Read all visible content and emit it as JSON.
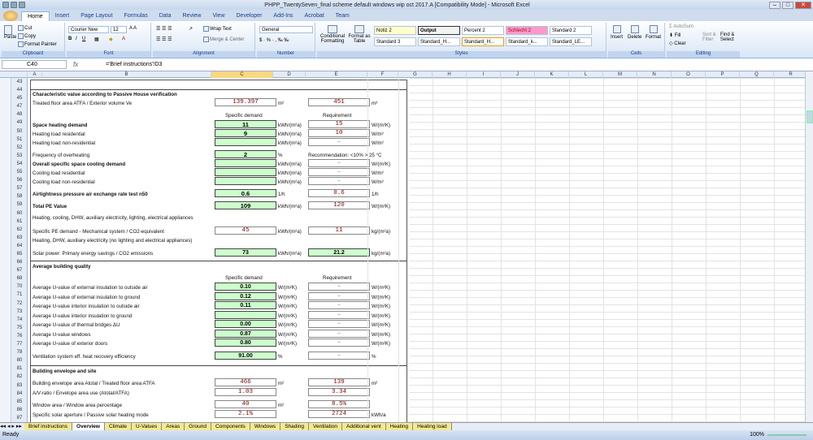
{
  "window": {
    "title": "PHPP_TwentySeven_final scheme default windows wip oct 2017.A  [Compatibility Mode] - Microsoft Excel"
  },
  "tabs": [
    "Home",
    "Insert",
    "Page Layout",
    "Formulas",
    "Data",
    "Review",
    "View",
    "Developer",
    "Add-Ins",
    "Acrobat",
    "Team"
  ],
  "ribbon": {
    "paste": "Paste",
    "cut": "Cut",
    "copy": "Copy",
    "format_painter": "Format Painter",
    "font_name": "Courier New",
    "font_size": "12",
    "wrap_text": "Wrap Text",
    "merge_center": "Merge & Center",
    "number_format": "General",
    "conditional_formatting": "Conditional Formatting",
    "format_as_table": "Format as Table",
    "styles": [
      "Notiz 2",
      "Output",
      "Percent 2",
      "Schlecht 2",
      "Standard 2",
      "Standard 3",
      "Standard_H...",
      "Standard_H...",
      "Standard_k...",
      "Standard_LE..."
    ],
    "insert": "Insert",
    "delete": "Delete",
    "format": "Format",
    "autosum": "AutoSum",
    "fill": "Fill",
    "clear": "Clear",
    "sort_filter": "Sort & Filter",
    "find_select": "Find & Select",
    "groups": [
      "Clipboard",
      "Font",
      "Alignment",
      "Number",
      "Styles",
      "Cells",
      "Editing"
    ]
  },
  "formula_bar": {
    "name_box": "C40",
    "fx": "fx",
    "formula": "='Brief instructions'!D3"
  },
  "columns": [
    "A",
    "B",
    "C",
    "D",
    "E",
    "F",
    "G",
    "H",
    "I",
    "J",
    "K",
    "L",
    "M",
    "N",
    "O",
    "P",
    "Q",
    "R",
    "S"
  ],
  "rows": [
    "43",
    "44",
    "45",
    "47",
    "48",
    "49",
    "50",
    "51",
    "52",
    "53",
    "54",
    "55",
    "56",
    "57",
    "58",
    "59",
    "60",
    "61",
    "62",
    "63",
    "64",
    "65",
    "66",
    "67",
    "68",
    "70",
    "71",
    "72",
    "73",
    "74",
    "75",
    "76",
    "77",
    "78",
    "80",
    "81",
    "82",
    "83",
    "84",
    "85",
    "86",
    "87"
  ],
  "sections": {
    "s1": "Characteristic value according to Passive House verification",
    "s2": "Average building quality",
    "s3": "Building envelope and site"
  },
  "headers": {
    "specific_demand": "Specific demand",
    "requirement": "Requirement"
  },
  "tfa": {
    "label": "Treated floor area ATFA / Exterior volume Ve",
    "value": "139.397",
    "unit": "m²",
    "req": "451",
    "req_unit": "m³"
  },
  "rows1": [
    {
      "label": "Space heating demand",
      "bold": true,
      "value": "11",
      "unit": "kWh/(m²a)",
      "req": "15",
      "req_unit": "W/(m²K)"
    },
    {
      "label": "Heating load residential",
      "bold": false,
      "value": "9",
      "unit": "kWh/(m²a)",
      "req": "10",
      "req_unit": "W/m²"
    },
    {
      "label": "Heating load non-residential",
      "bold": false,
      "value": "",
      "unit": "kWh/(m²a)",
      "req": "–",
      "req_unit": "W/m²"
    },
    {
      "label": "Frequency of overheating",
      "bold": false,
      "value": "2",
      "unit": "%",
      "req": "Recommendation: <10% > 25 °C",
      "req_unit": ""
    },
    {
      "label": "Overall specific space cooling demand",
      "bold": true,
      "value": "",
      "unit": "kWh/(m²a)",
      "req": "–",
      "req_unit": "W/(m²K)"
    },
    {
      "label": "Cooling load residential",
      "bold": false,
      "value": "",
      "unit": "kWh/(m²a)",
      "req": "–",
      "req_unit": "W/m²"
    },
    {
      "label": "Cooling load non-residential",
      "bold": false,
      "value": "",
      "unit": "kWh/(m²a)",
      "req": "–",
      "req_unit": "W/m²"
    },
    {
      "label": "Airtightness pressure air exchange rate test n50",
      "bold": true,
      "value": "0.6",
      "unit": "1/h",
      "req": "0.6",
      "req_unit": "1/h"
    },
    {
      "label": "Total PE Value",
      "bold": true,
      "value": "109",
      "unit": "kWh/(m²a)",
      "req": "120",
      "req_unit": "W/(m²K)"
    }
  ],
  "note1": "Heating, cooling, DHW, auxiliary electricity, lighting, electrical appliances",
  "pe_mech": {
    "label": "Specific PE demand - Mechanical system / CO2-equivalent",
    "value": "45",
    "unit": "kWh/(m²a)",
    "req": "11",
    "req_unit": "kg/(m²a)"
  },
  "note2": "Heating, DHW, auxiliary electricity (no lighting and electrical appliances)",
  "solar": {
    "label": "Solar power: Primary energy savings / CO2 emissions",
    "value": "73",
    "unit": "kWh/(m²a)",
    "req": "21.2",
    "req_unit": "kg/(m²a)"
  },
  "rows2": [
    {
      "label": "Average U-value of external insulation to outside air",
      "value": "0.10",
      "unit": "W/(m²K)",
      "req": "–",
      "req_unit": "W/(m²K)"
    },
    {
      "label": "Average U-value of external insulation to ground",
      "value": "0.12",
      "unit": "W/(m²K)",
      "req": "–",
      "req_unit": "W/(m²K)"
    },
    {
      "label": "Average U-value interior insulation to outside air",
      "value": "0.11",
      "unit": "W/(m²K)",
      "req": "–",
      "req_unit": "W/(m²K)"
    },
    {
      "label": "Average U-value interior insulation to ground",
      "value": "",
      "unit": "W/(m²K)",
      "req": "–",
      "req_unit": "W/(m²K)"
    },
    {
      "label": "Average U-value of thermal bridges ΔU",
      "value": "0.00",
      "unit": "W/(m²K)",
      "req": "–",
      "req_unit": "W/(m²K)"
    },
    {
      "label": "Average U-value windows",
      "value": "0.87",
      "unit": "W/(m²K)",
      "req": "–",
      "req_unit": "W/(m²K)"
    },
    {
      "label": "Average U-value of exterior doors",
      "value": "0.80",
      "unit": "W/(m²K)",
      "req": "–",
      "req_unit": "W/(m²K)"
    }
  ],
  "ventilation": {
    "label": "Ventilation system eff. heat recovery efficiency",
    "value": "91.00",
    "unit": "%",
    "req": "–",
    "req_unit": "%"
  },
  "rows3": [
    {
      "label": "Building envelope area Atotal / Treated floor area ATFA",
      "value": "466",
      "unit": "m²",
      "req": "139",
      "req_unit": "m²"
    },
    {
      "label": "A/V-ratio / Envelope area use (Atotal/ATFA)",
      "value": "1.03",
      "unit": "",
      "req": "3.34",
      "req_unit": ""
    },
    {
      "label": "Window area / Window area percentage",
      "value": "40",
      "unit": "m²",
      "req": "8.5%",
      "req_unit": ""
    },
    {
      "label": "Specific solar aperture / Passive solar heating mode",
      "value": "2.1%",
      "unit": "",
      "req": "2724",
      "req_unit": "kWh/a"
    }
  ],
  "sheet_tabs": [
    "Brief instructions",
    "Overview",
    "Climate",
    "U-Values",
    "Areas",
    "Ground",
    "Components",
    "Windows",
    "Shading",
    "Ventilation",
    "Additional vent",
    "Heating",
    "Heating load"
  ],
  "active_sheet": "Overview",
  "status": {
    "ready": "Ready",
    "zoom": "100%"
  }
}
